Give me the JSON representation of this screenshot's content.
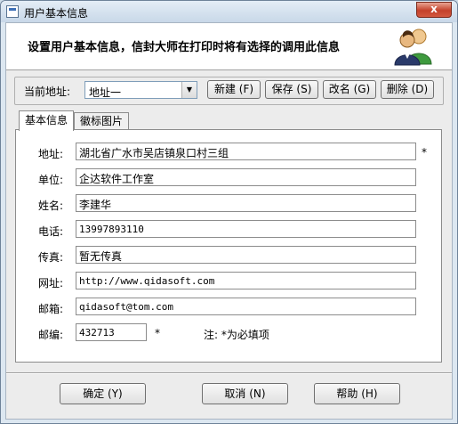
{
  "window": {
    "title": "用户基本信息",
    "close_glyph": "x"
  },
  "header": {
    "text": "设置用户基本信息，信封大师在打印时将有选择的调用此信息",
    "icon": "users-icon"
  },
  "address_bar": {
    "label": "当前地址:",
    "selected": "地址一",
    "buttons": {
      "new": "新建 (F)",
      "save": "保存 (S)",
      "rename": "改名 (G)",
      "delete": "删除 (D)"
    }
  },
  "tabs": [
    {
      "label": "基本信息",
      "active": true
    },
    {
      "label": "徽标图片",
      "active": false
    }
  ],
  "form": {
    "address": {
      "label": "地址:",
      "value": "湖北省广水市吴店镇泉口村三组",
      "required": "*"
    },
    "company": {
      "label": "单位:",
      "value": "企达软件工作室"
    },
    "name": {
      "label": "姓名:",
      "value": "李建华"
    },
    "phone": {
      "label": "电话:",
      "value": "13997893110"
    },
    "fax": {
      "label": "传真:",
      "value": "暂无传真"
    },
    "website": {
      "label": "网址:",
      "value": "http://www.qidasoft.com"
    },
    "email": {
      "label": "邮箱:",
      "value": "qidasoft@tom.com"
    },
    "zip": {
      "label": "邮编:",
      "value": "432713",
      "required": "*"
    },
    "note": "注: *为必填项"
  },
  "footer": {
    "ok": "确定 (Y)",
    "cancel": "取消 (N)",
    "help": "帮助 (H)"
  }
}
